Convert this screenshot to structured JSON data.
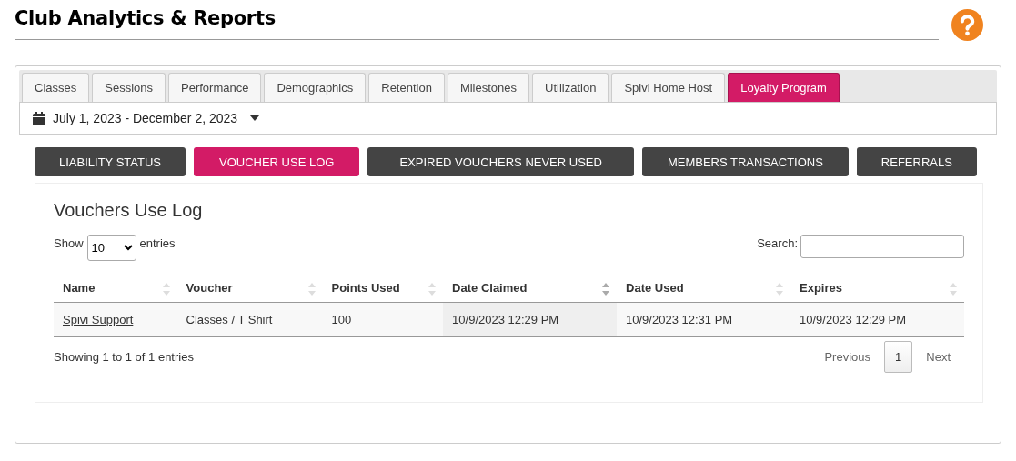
{
  "page_title": "Club Analytics & Reports",
  "tabs": [
    {
      "label": "Classes",
      "selected": false
    },
    {
      "label": "Sessions",
      "selected": false
    },
    {
      "label": "Performance",
      "selected": false
    },
    {
      "label": "Demographics",
      "selected": false
    },
    {
      "label": "Retention",
      "selected": false
    },
    {
      "label": "Milestones",
      "selected": false
    },
    {
      "label": "Utilization",
      "selected": false
    },
    {
      "label": "Spivi Home Host",
      "selected": false
    },
    {
      "label": "Loyalty Program",
      "selected": true
    }
  ],
  "date_range": "July 1, 2023 - December 2, 2023",
  "report_buttons": [
    {
      "label": "LIABILITY STATUS",
      "selected": false
    },
    {
      "label": "VOUCHER USE LOG",
      "selected": true
    },
    {
      "label": "EXPIRED VOUCHERS NEVER USED",
      "selected": false
    },
    {
      "label": "MEMBERS TRANSACTIONS",
      "selected": false
    },
    {
      "label": "REFERRALS",
      "selected": false
    }
  ],
  "section_title": "Vouchers Use Log",
  "length_menu": {
    "prefix": "Show",
    "value": "10",
    "suffix": "entries"
  },
  "search_label": "Search:",
  "table": {
    "columns": [
      {
        "label": "Name",
        "sorted": false
      },
      {
        "label": "Voucher",
        "sorted": false
      },
      {
        "label": "Points Used",
        "sorted": false
      },
      {
        "label": "Date Claimed",
        "sorted": true
      },
      {
        "label": "Date Used",
        "sorted": false
      },
      {
        "label": "Expires",
        "sorted": false
      }
    ],
    "rows": [
      {
        "cells": [
          "Spivi Support",
          "Classes / T Shirt",
          "100",
          "10/9/2023 12:29 PM",
          "10/9/2023 12:31 PM",
          "10/9/2023 12:29 PM"
        ]
      }
    ]
  },
  "info": "Showing 1 to 1 of 1 entries",
  "pagination": [
    {
      "label": "Previous",
      "kind": "nav",
      "selected": false
    },
    {
      "label": "1",
      "kind": "page",
      "selected": true
    },
    {
      "label": "Next",
      "kind": "nav",
      "selected": false
    }
  ]
}
